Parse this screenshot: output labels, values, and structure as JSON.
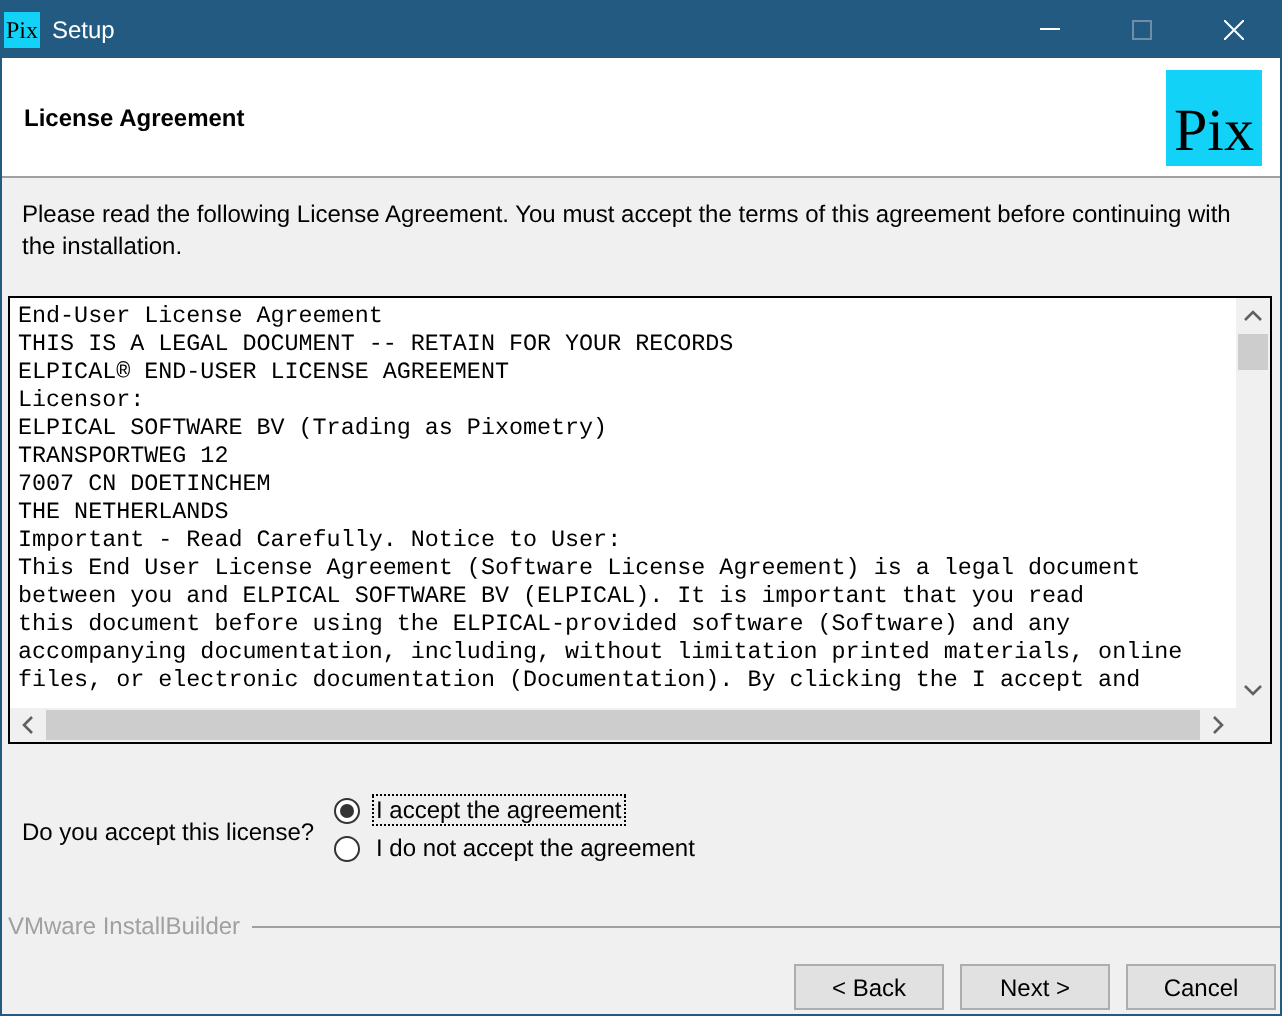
{
  "window": {
    "title": "Setup",
    "app_icon_text": "Pix"
  },
  "header": {
    "title": "License Agreement",
    "logo_text": "Pix"
  },
  "intro": "Please read the following License Agreement. You must accept the terms of this agreement before continuing with the installation.",
  "license_lines": [
    "End-User License Agreement",
    "THIS IS A LEGAL DOCUMENT -- RETAIN FOR YOUR RECORDS",
    "ELPICAL® END-USER LICENSE AGREEMENT",
    "Licensor:",
    "ELPICAL SOFTWARE BV (Trading as Pixometry)",
    "TRANSPORTWEG 12",
    "7007 CN DOETINCHEM",
    "THE NETHERLANDS",
    "Important - Read Carefully. Notice to User:",
    "This End User License Agreement (Software License Agreement) is a legal document",
    "between you and ELPICAL SOFTWARE BV (ELPICAL). It is important that you read",
    "this document before using the ELPICAL-provided software (Software) and any",
    "accompanying documentation, including, without limitation printed materials, online",
    "files, or electronic documentation (Documentation). By clicking the I accept and"
  ],
  "question": "Do you accept this license?",
  "options": [
    {
      "label": "I accept the agreement",
      "selected": true,
      "focused": true
    },
    {
      "label": "I do not accept the agreement",
      "selected": false,
      "focused": false
    }
  ],
  "brand": "VMware InstallBuilder",
  "buttons": [
    "< Back",
    "Next >",
    "Cancel"
  ]
}
